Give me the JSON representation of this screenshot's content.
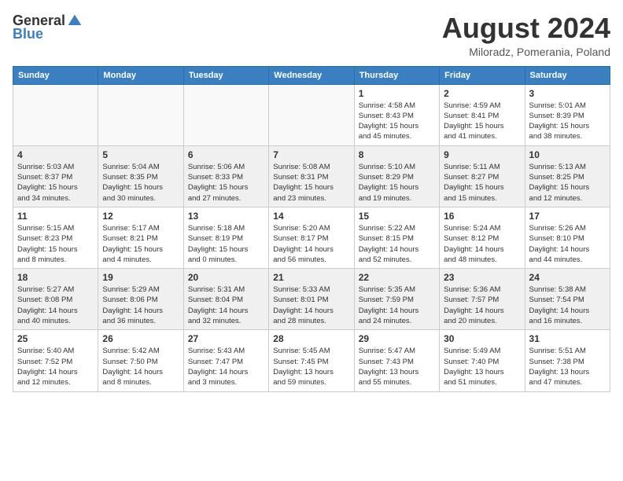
{
  "logo": {
    "general": "General",
    "blue": "Blue"
  },
  "title": "August 2024",
  "location": "Miloradz, Pomerania, Poland",
  "days_of_week": [
    "Sunday",
    "Monday",
    "Tuesday",
    "Wednesday",
    "Thursday",
    "Friday",
    "Saturday"
  ],
  "weeks": [
    [
      {
        "day": "",
        "info": "",
        "empty": true
      },
      {
        "day": "",
        "info": "",
        "empty": true
      },
      {
        "day": "",
        "info": "",
        "empty": true
      },
      {
        "day": "",
        "info": "",
        "empty": true
      },
      {
        "day": "1",
        "info": "Sunrise: 4:58 AM\nSunset: 8:43 PM\nDaylight: 15 hours\nand 45 minutes."
      },
      {
        "day": "2",
        "info": "Sunrise: 4:59 AM\nSunset: 8:41 PM\nDaylight: 15 hours\nand 41 minutes."
      },
      {
        "day": "3",
        "info": "Sunrise: 5:01 AM\nSunset: 8:39 PM\nDaylight: 15 hours\nand 38 minutes."
      }
    ],
    [
      {
        "day": "4",
        "info": "Sunrise: 5:03 AM\nSunset: 8:37 PM\nDaylight: 15 hours\nand 34 minutes."
      },
      {
        "day": "5",
        "info": "Sunrise: 5:04 AM\nSunset: 8:35 PM\nDaylight: 15 hours\nand 30 minutes."
      },
      {
        "day": "6",
        "info": "Sunrise: 5:06 AM\nSunset: 8:33 PM\nDaylight: 15 hours\nand 27 minutes."
      },
      {
        "day": "7",
        "info": "Sunrise: 5:08 AM\nSunset: 8:31 PM\nDaylight: 15 hours\nand 23 minutes."
      },
      {
        "day": "8",
        "info": "Sunrise: 5:10 AM\nSunset: 8:29 PM\nDaylight: 15 hours\nand 19 minutes."
      },
      {
        "day": "9",
        "info": "Sunrise: 5:11 AM\nSunset: 8:27 PM\nDaylight: 15 hours\nand 15 minutes."
      },
      {
        "day": "10",
        "info": "Sunrise: 5:13 AM\nSunset: 8:25 PM\nDaylight: 15 hours\nand 12 minutes."
      }
    ],
    [
      {
        "day": "11",
        "info": "Sunrise: 5:15 AM\nSunset: 8:23 PM\nDaylight: 15 hours\nand 8 minutes."
      },
      {
        "day": "12",
        "info": "Sunrise: 5:17 AM\nSunset: 8:21 PM\nDaylight: 15 hours\nand 4 minutes."
      },
      {
        "day": "13",
        "info": "Sunrise: 5:18 AM\nSunset: 8:19 PM\nDaylight: 15 hours\nand 0 minutes."
      },
      {
        "day": "14",
        "info": "Sunrise: 5:20 AM\nSunset: 8:17 PM\nDaylight: 14 hours\nand 56 minutes."
      },
      {
        "day": "15",
        "info": "Sunrise: 5:22 AM\nSunset: 8:15 PM\nDaylight: 14 hours\nand 52 minutes."
      },
      {
        "day": "16",
        "info": "Sunrise: 5:24 AM\nSunset: 8:12 PM\nDaylight: 14 hours\nand 48 minutes."
      },
      {
        "day": "17",
        "info": "Sunrise: 5:26 AM\nSunset: 8:10 PM\nDaylight: 14 hours\nand 44 minutes."
      }
    ],
    [
      {
        "day": "18",
        "info": "Sunrise: 5:27 AM\nSunset: 8:08 PM\nDaylight: 14 hours\nand 40 minutes."
      },
      {
        "day": "19",
        "info": "Sunrise: 5:29 AM\nSunset: 8:06 PM\nDaylight: 14 hours\nand 36 minutes."
      },
      {
        "day": "20",
        "info": "Sunrise: 5:31 AM\nSunset: 8:04 PM\nDaylight: 14 hours\nand 32 minutes."
      },
      {
        "day": "21",
        "info": "Sunrise: 5:33 AM\nSunset: 8:01 PM\nDaylight: 14 hours\nand 28 minutes."
      },
      {
        "day": "22",
        "info": "Sunrise: 5:35 AM\nSunset: 7:59 PM\nDaylight: 14 hours\nand 24 minutes."
      },
      {
        "day": "23",
        "info": "Sunrise: 5:36 AM\nSunset: 7:57 PM\nDaylight: 14 hours\nand 20 minutes."
      },
      {
        "day": "24",
        "info": "Sunrise: 5:38 AM\nSunset: 7:54 PM\nDaylight: 14 hours\nand 16 minutes."
      }
    ],
    [
      {
        "day": "25",
        "info": "Sunrise: 5:40 AM\nSunset: 7:52 PM\nDaylight: 14 hours\nand 12 minutes."
      },
      {
        "day": "26",
        "info": "Sunrise: 5:42 AM\nSunset: 7:50 PM\nDaylight: 14 hours\nand 8 minutes."
      },
      {
        "day": "27",
        "info": "Sunrise: 5:43 AM\nSunset: 7:47 PM\nDaylight: 14 hours\nand 3 minutes."
      },
      {
        "day": "28",
        "info": "Sunrise: 5:45 AM\nSunset: 7:45 PM\nDaylight: 13 hours\nand 59 minutes."
      },
      {
        "day": "29",
        "info": "Sunrise: 5:47 AM\nSunset: 7:43 PM\nDaylight: 13 hours\nand 55 minutes."
      },
      {
        "day": "30",
        "info": "Sunrise: 5:49 AM\nSunset: 7:40 PM\nDaylight: 13 hours\nand 51 minutes."
      },
      {
        "day": "31",
        "info": "Sunrise: 5:51 AM\nSunset: 7:38 PM\nDaylight: 13 hours\nand 47 minutes."
      }
    ]
  ]
}
